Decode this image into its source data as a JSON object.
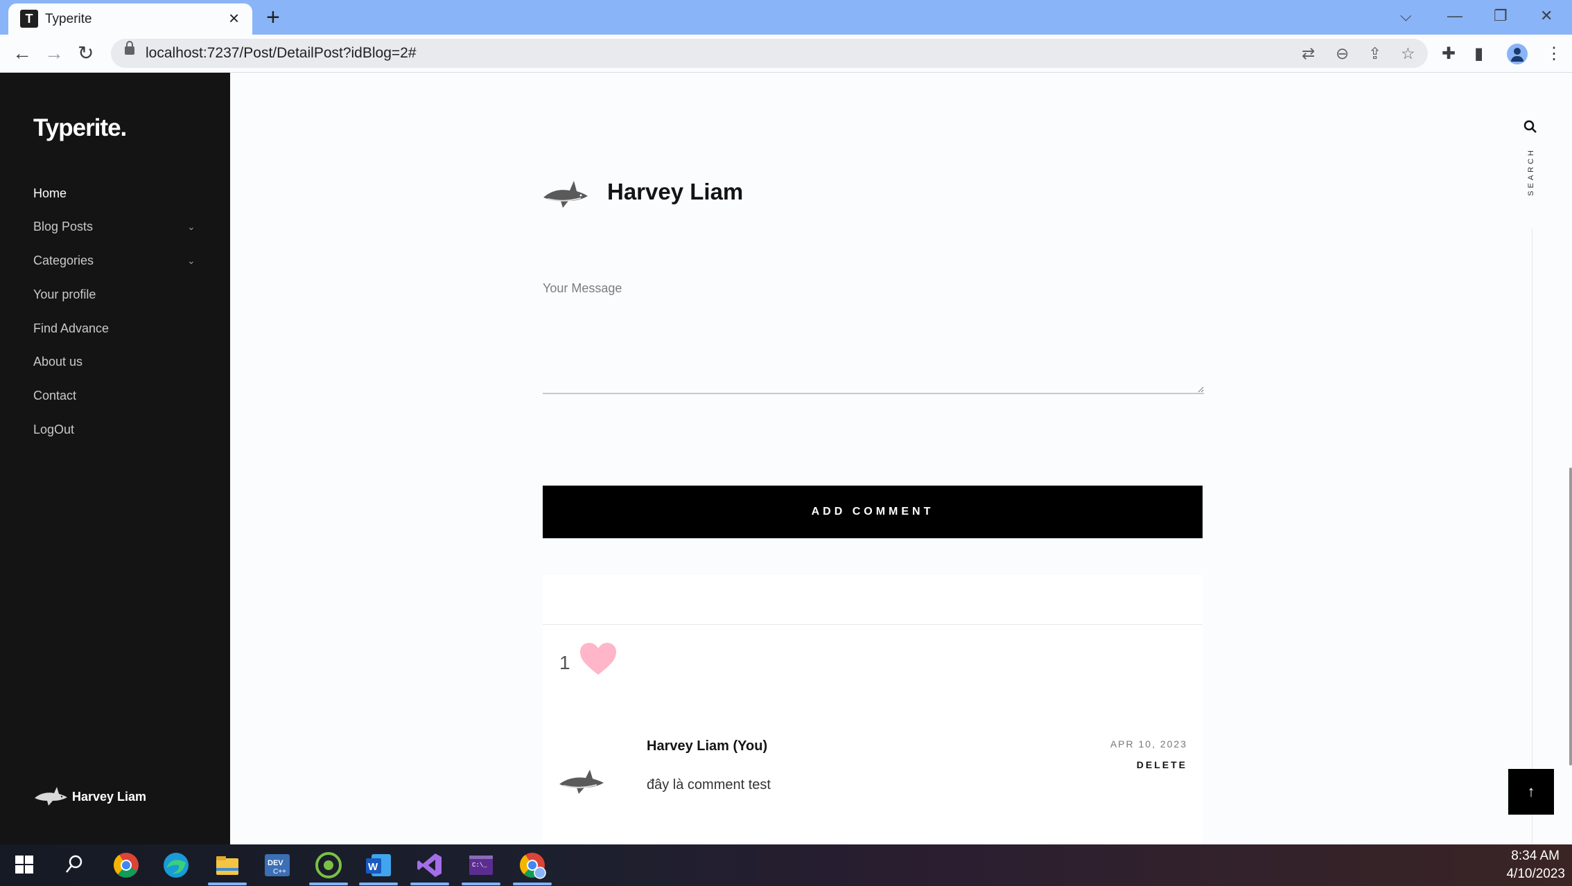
{
  "browser": {
    "tab_title": "Typerite",
    "tab_favicon_letter": "T",
    "url": "localhost:7237/Post/DetailPost?idBlog=2#"
  },
  "sidebar": {
    "brand": "Typerite.",
    "items": [
      {
        "label": "Home"
      },
      {
        "label": "Blog Posts"
      },
      {
        "label": "Categories"
      },
      {
        "label": "Your profile"
      },
      {
        "label": "Find Advance"
      },
      {
        "label": "About us"
      },
      {
        "label": "Contact"
      },
      {
        "label": "LogOut"
      }
    ],
    "user_name": "Harvey Liam"
  },
  "main": {
    "author_name": "Harvey Liam",
    "message_placeholder": "Your Message",
    "add_comment_label": "ADD COMMENT",
    "like_count": "1",
    "search_label": "SEARCH",
    "to_top_label": "↑",
    "comment": {
      "author": "Harvey Liam (You)",
      "date": "APR 10, 2023",
      "delete_label": "DELETE",
      "text": "đây là comment test"
    }
  },
  "taskbar": {
    "time": "8:34 AM",
    "date": "4/10/2023",
    "apps": [
      "chrome-icon",
      "edge-icon",
      "file-explorer-icon",
      "devc-icon",
      "app-icon",
      "word-icon",
      "visual-studio-icon",
      "terminal-icon",
      "chrome-profile-icon"
    ]
  },
  "colors": {
    "tabbar": "#8ab4f8",
    "sidebar": "#141414",
    "button": "#000000",
    "heart": "#ffb6c8"
  }
}
